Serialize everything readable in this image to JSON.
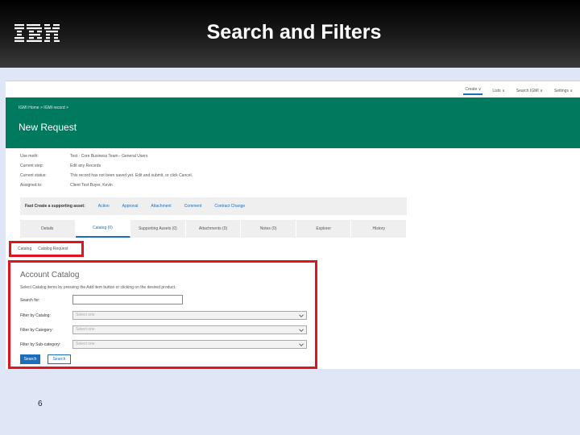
{
  "slide": {
    "logo": "IBM",
    "title": "Search and Filters",
    "page_number": "6"
  },
  "topnav": {
    "items": [
      "Create ∨",
      "Lists ∨",
      "Search IGMI ∨",
      "Settings ∨"
    ]
  },
  "header": {
    "breadcrumb": "IGMI Home  >  IGMI record  >",
    "page_title": "New Request"
  },
  "request_info": {
    "rows": [
      {
        "label": "Use meth:",
        "value": "Test - Core Business Team - General Users"
      },
      {
        "label": "Current step:",
        "value": "Edit any Records"
      },
      {
        "label": "Current status:",
        "value": "This record has not been saved yet. Edit and submit, or click Cancel."
      },
      {
        "label": "Assigned to:",
        "value": "Client Test Buyer, Kevin"
      }
    ]
  },
  "fast_create": {
    "label": "Fast Create a supporting asset:",
    "links": [
      "Action",
      "Approval",
      "Attachment",
      "Comment",
      "Contract Change"
    ]
  },
  "tabs": [
    "Details",
    "Catalog (0)",
    "Supporting Assets (0)",
    "Attachments (0)",
    "Notes (0)",
    "Explorer",
    "History"
  ],
  "subtabs": [
    "Catalog",
    "Catalog Request"
  ],
  "catalog": {
    "title": "Account Catalog",
    "instructions": "Select Catalog items by pressing the Add item button or clicking on the desired product.",
    "search_label": "Search for:",
    "search_value": "",
    "filters": [
      {
        "label": "Filter by Catalog:",
        "value": "Select one"
      },
      {
        "label": "Filter by Category:",
        "value": "Select one"
      },
      {
        "label": "Filter by Sub-category:",
        "value": "Select one"
      }
    ],
    "search_button": "Search",
    "clear_button": "Search"
  }
}
